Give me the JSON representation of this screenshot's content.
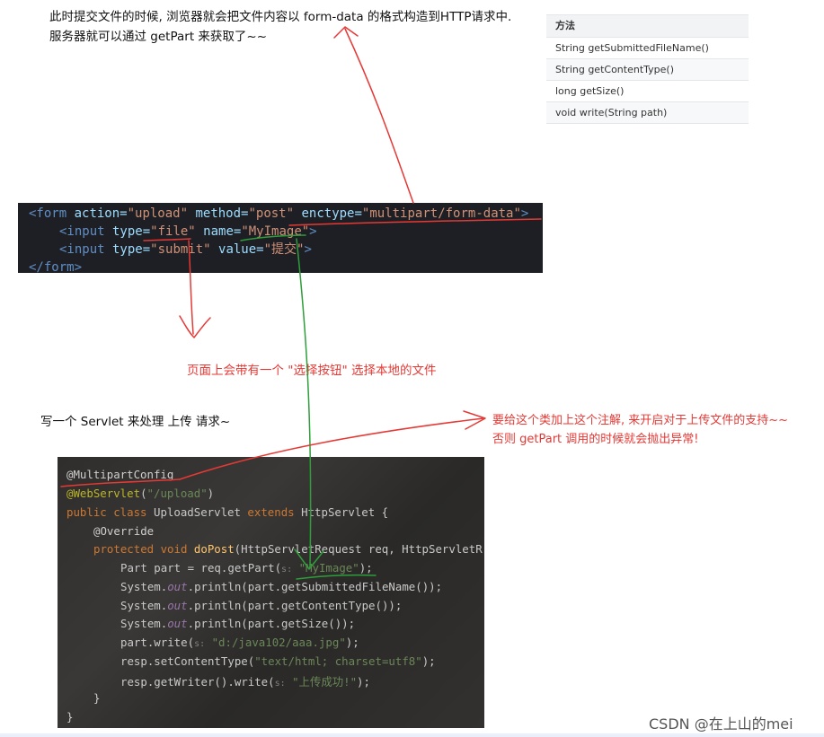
{
  "top_note": {
    "line1": "此时提交文件的时候, 浏览器就会把文件内容以 form-data 的格式构造到HTTP请求中.",
    "line2": "服务器就可以通过 getPart 来获取了~~"
  },
  "method_table": {
    "header": "方法",
    "rows": [
      "String getSubmittedFileName()",
      "String getContentType()",
      "long getSize()",
      "void write(String path)"
    ]
  },
  "form_code": {
    "l1": {
      "open": "<form",
      "a1": " action=",
      "v1": "\"upload\"",
      "a2": " method=",
      "v2": "\"post\"",
      "a3": " enctype=",
      "v3": "\"multipart/form-data\"",
      "close": ">"
    },
    "l2": {
      "open": "<input",
      "a1": " type=",
      "v1": "\"file\"",
      "a2": " name=",
      "v2": "\"MyImage\"",
      "close": ">"
    },
    "l3": {
      "open": "<input",
      "a1": " type=",
      "v1": "\"submit\"",
      "a2": " value=",
      "v2": "\"提交\"",
      "close": ">"
    },
    "l4": "</form>"
  },
  "red_note_button": "页面上会带有一个 \"选择按钮\" 选择本地的文件",
  "servlet_note": "写一个 Servlet 来处理 上传 请求~",
  "red_note_annotation": {
    "line1": "要给这个类加上这个注解, 来开启对于上传文件的支持~~",
    "line2": "否则 getPart 调用的时候就会抛出异常!"
  },
  "servlet_code": {
    "ann1": "@MultipartConfig",
    "ann2": "@WebServlet",
    "ann2_arg": "\"/upload\"",
    "l3_kw": "public class ",
    "l3_name": "UploadServlet ",
    "l3_ext": "extends ",
    "l3_rest": "HttpServlet {",
    "override": "@Override",
    "l5_kw": "protected void ",
    "l5_fn": "doPost",
    "l5_rest": "(HttpServletRequest req, HttpServletR",
    "l6_pre": "Part part = req.getPart(",
    "hint_s": "s:",
    "l6_str": "\"MyImage\"",
    "l6_end": ");",
    "sys": "System.",
    "out": "out",
    "l7_rest": ".println(part.getSubmittedFileName());",
    "l8_rest": ".println(part.getContentType());",
    "l9_rest": ".println(part.getSize());",
    "l10_pre": "part.write(",
    "l10_str": "\"d:/java102/aaa.jpg\"",
    "l10_end": ");",
    "l11_pre": "resp.setContentType(",
    "l11_str": "\"text/html; charset=utf8\"",
    "l11_end": ");",
    "l12_pre": "resp.getWriter().write(",
    "l12_str": "\"上传成功!\"",
    "l12_end": ");",
    "brace_inner": "}",
    "brace_outer": "}"
  },
  "watermark": "CSDN @在上山的mei",
  "annotation_colors": {
    "red": "#e53935",
    "green": "#2e9e3a"
  }
}
